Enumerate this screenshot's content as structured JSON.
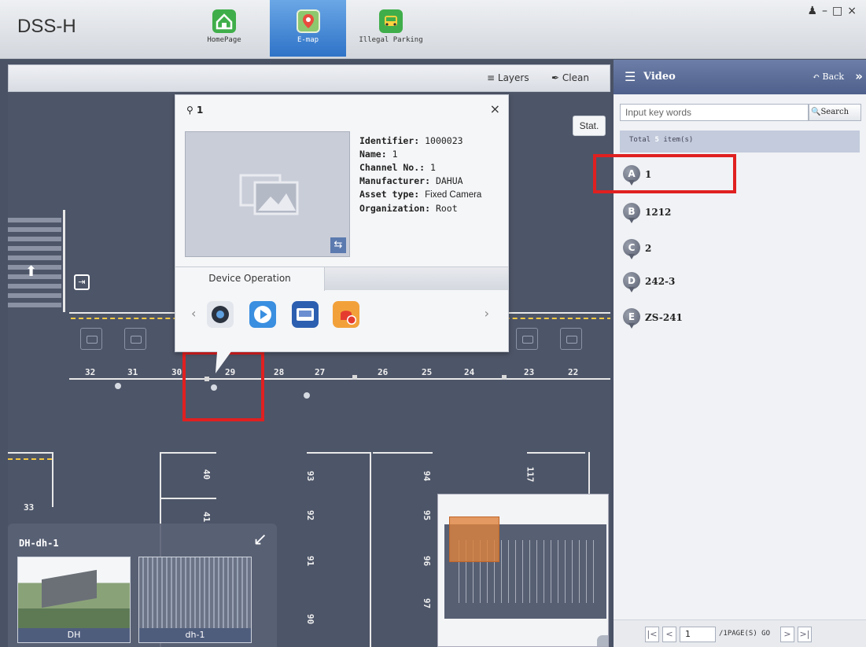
{
  "app": {
    "title": "DSS-H"
  },
  "nav": [
    {
      "label": "HomePage",
      "icon": "home-icon",
      "color": "#3fae4a"
    },
    {
      "label": "E-map",
      "icon": "map-pin-icon",
      "color": "#3aa0d8"
    },
    {
      "label": "Illegal Parking",
      "icon": "car-icon",
      "color": "#3fae4a"
    }
  ],
  "map_toolbar": {
    "layers_label": "Layers",
    "clean_label": "Clean",
    "stat_label": "Stat."
  },
  "popup": {
    "title": "1",
    "fields": [
      {
        "key": "Identifier:",
        "value": "1000023"
      },
      {
        "key": "Name:",
        "value": "1"
      },
      {
        "key": "Channel No.:",
        "value": "1"
      },
      {
        "key": "Manufacturer:",
        "value": "DAHUA"
      },
      {
        "key": "Asset type:",
        "value": "Fixed Camera"
      },
      {
        "key": "Organization:",
        "value": "Root"
      }
    ],
    "ops_tab": "Device Operation",
    "op_icons": [
      "camera-icon",
      "play-icon",
      "vehicle-icon",
      "alarm-icon"
    ]
  },
  "map": {
    "slots_top": [
      "32",
      "31",
      "30",
      "29",
      "28",
      "27",
      "26",
      "25",
      "24",
      "23",
      "22"
    ],
    "slots_col": [
      "40",
      "41",
      "93",
      "92",
      "91",
      "90",
      "94",
      "95",
      "96",
      "97",
      "117"
    ],
    "slot_33": "33"
  },
  "map_panel": {
    "title": "DH-dh-1",
    "thumb1": "DH",
    "thumb2": "dh-1"
  },
  "sidebar": {
    "title": "Video",
    "back_label": "Back",
    "search_placeholder": "Input key words",
    "search_btn": "Search",
    "total_prefix": "Total",
    "total_count": "5",
    "total_suffix": "item(s)",
    "items": [
      {
        "letter": "A",
        "label": "1"
      },
      {
        "letter": "B",
        "label": "1212"
      },
      {
        "letter": "C",
        "label": "2"
      },
      {
        "letter": "D",
        "label": "242-3"
      },
      {
        "letter": "E",
        "label": "ZS-241"
      }
    ],
    "pager": {
      "page": "1",
      "pages_text": "/1PAGE(S) GO"
    }
  },
  "colors": {
    "accent": "#2f73c8",
    "highlight": "#e02020",
    "sidebar_header": "#5a6b96"
  }
}
